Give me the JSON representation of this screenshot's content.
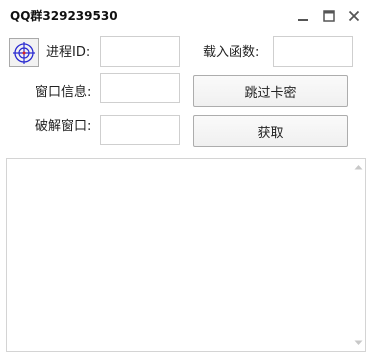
{
  "window": {
    "title": "QQ群329239530"
  },
  "titlebar_icons": {
    "minimize": "minimize-icon",
    "maximize": "maximize-icon",
    "close": "close-icon"
  },
  "tool": {
    "crosshair_icon": "crosshair-target-icon",
    "accent_color": "#2b2bd1"
  },
  "form": {
    "pid_label": "进程ID:",
    "pid_value": "",
    "func_label": "载入函数:",
    "func_value": "",
    "info_label": "窗口信息:",
    "info_value": "",
    "crack_label": "破解窗口:",
    "crack_value": ""
  },
  "buttons": {
    "skip_label": "跳过卡密",
    "get_label": "获取"
  },
  "output": {
    "text": ""
  }
}
